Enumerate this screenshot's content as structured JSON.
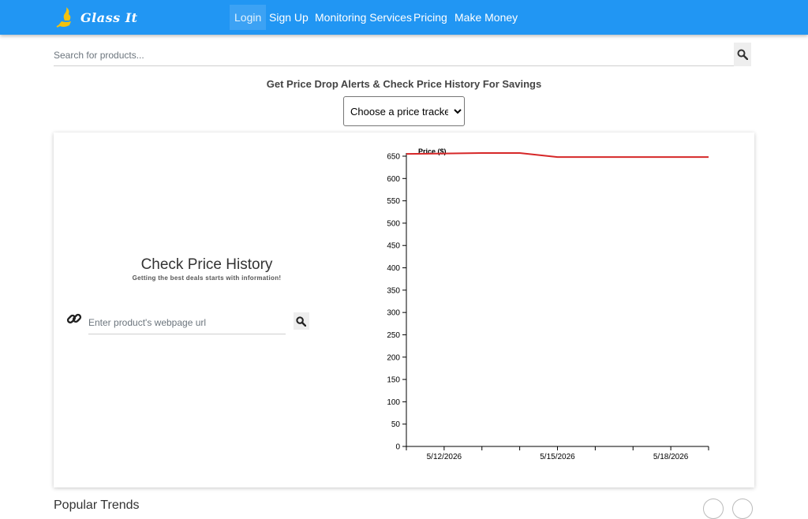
{
  "navbar": {
    "brand": "Glass It",
    "links": [
      {
        "label": "Login",
        "active": true
      },
      {
        "label": "Sign Up"
      },
      {
        "label": "Monitoring Services"
      },
      {
        "label": "Pricing"
      },
      {
        "label": "Make Money"
      }
    ],
    "color": "#2196f3"
  },
  "search": {
    "placeholder": "Search for products..."
  },
  "tagline": "Get Price Drop Alerts & Check Price History For Savings",
  "tracker_select": {
    "selected": "Choose a price tracker"
  },
  "price_history": {
    "title": "Check Price History",
    "subtitle": "Getting the best deals starts with information!",
    "url_placeholder": "Enter product's webpage url"
  },
  "chart_data": {
    "type": "line",
    "title": "Price ($)",
    "ylim": [
      0,
      650
    ],
    "yticks": [
      0,
      50,
      100,
      150,
      200,
      250,
      300,
      350,
      400,
      450,
      500,
      550,
      600,
      650
    ],
    "xticklabels": [
      "5/12/2026",
      "5/15/2026",
      "5/18/2026"
    ],
    "series": [
      {
        "color": "#d62728",
        "x": [
          "5/11/2026",
          "5/12/2026",
          "5/13/2026",
          "5/14/2026",
          "5/15/2026",
          "5/16/2026",
          "5/17/2026",
          "5/18/2026",
          "5/19/2026"
        ],
        "values": [
          655,
          656,
          657,
          657,
          648,
          648,
          648,
          648,
          648
        ]
      }
    ]
  },
  "bottom": {
    "heading": "Popular Trends"
  }
}
